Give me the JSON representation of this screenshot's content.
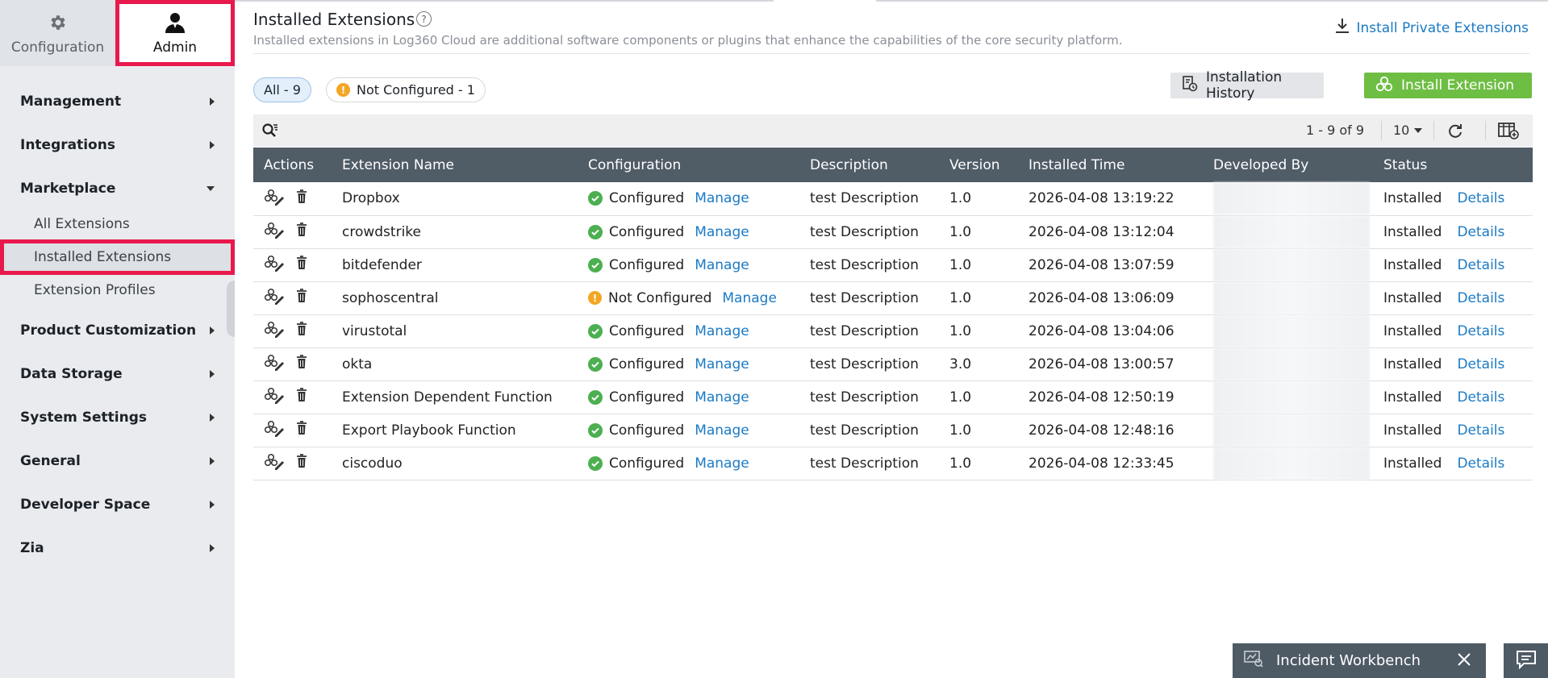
{
  "top_tabs": {
    "configuration": {
      "label": "Configuration",
      "icon": "gear-icon"
    },
    "admin": {
      "label": "Admin",
      "icon": "user-icon"
    }
  },
  "sidebar": {
    "sections": [
      {
        "label": "Management",
        "icon": "chevron-right-icon"
      },
      {
        "label": "Integrations",
        "icon": "chevron-right-icon"
      },
      {
        "label": "Marketplace",
        "icon": "chevron-down-icon",
        "children": [
          "All Extensions",
          "Installed Extensions",
          "Extension Profiles"
        ],
        "active_child": "Installed Extensions"
      },
      {
        "label": "Product Customization",
        "icon": "chevron-right-icon"
      },
      {
        "label": "Data Storage",
        "icon": "chevron-right-icon"
      },
      {
        "label": "System Settings",
        "icon": "chevron-right-icon"
      },
      {
        "label": "General",
        "icon": "chevron-right-icon"
      },
      {
        "label": "Developer Space",
        "icon": "chevron-right-icon"
      },
      {
        "label": "Zia",
        "icon": "chevron-right-icon"
      }
    ]
  },
  "header": {
    "title": "Installed Extensions",
    "subtitle": "Installed extensions in Log360 Cloud are additional software components or plugins that enhance the capabilities of the core security platform.",
    "private_link": "Install Private Extensions"
  },
  "filters": {
    "all": "All - 9",
    "not_configured": "Not Configured - 1"
  },
  "buttons": {
    "history": "Installation History",
    "install": "Install Extension"
  },
  "toolbar": {
    "pager": "1 - 9 of 9",
    "page_size": "10"
  },
  "table": {
    "columns": [
      "Actions",
      "Extension Name",
      "Configuration",
      "Description",
      "Version",
      "Installed Time",
      "Developed By",
      "Status"
    ],
    "rows": [
      {
        "name": "Dropbox",
        "config": "Configured",
        "configured": true,
        "manage": "Manage",
        "description": "test Description",
        "version": "1.0",
        "time": "2026-04-08 13:19:22",
        "status": "Installed",
        "details": "Details"
      },
      {
        "name": "crowdstrike",
        "config": "Configured",
        "configured": true,
        "manage": "Manage",
        "description": "test Description",
        "version": "1.0",
        "time": "2026-04-08 13:12:04",
        "status": "Installed",
        "details": "Details"
      },
      {
        "name": "bitdefender",
        "config": "Configured",
        "configured": true,
        "manage": "Manage",
        "description": "test Description",
        "version": "1.0",
        "time": "2026-04-08 13:07:59",
        "status": "Installed",
        "details": "Details"
      },
      {
        "name": "sophoscentral",
        "config": "Not Configured",
        "configured": false,
        "manage": "Manage",
        "description": "test Description",
        "version": "1.0",
        "time": "2026-04-08 13:06:09",
        "status": "Installed",
        "details": "Details"
      },
      {
        "name": "virustotal",
        "config": "Configured",
        "configured": true,
        "manage": "Manage",
        "description": "test Description",
        "version": "1.0",
        "time": "2026-04-08 13:04:06",
        "status": "Installed",
        "details": "Details"
      },
      {
        "name": "okta",
        "config": "Configured",
        "configured": true,
        "manage": "Manage",
        "description": "test Description",
        "version": "3.0",
        "time": "2026-04-08 13:00:57",
        "status": "Installed",
        "details": "Details"
      },
      {
        "name": "Extension Dependent Function",
        "config": "Configured",
        "configured": true,
        "manage": "Manage",
        "description": "test Description",
        "version": "1.0",
        "time": "2026-04-08 12:50:19",
        "status": "Installed",
        "details": "Details"
      },
      {
        "name": "Export Playbook Function",
        "config": "Configured",
        "configured": true,
        "manage": "Manage",
        "description": "test Description",
        "version": "1.0",
        "time": "2026-04-08 12:48:16",
        "status": "Installed",
        "details": "Details"
      },
      {
        "name": "ciscoduo",
        "config": "Configured",
        "configured": true,
        "manage": "Manage",
        "description": "test Description",
        "version": "1.0",
        "time": "2026-04-08 12:33:45",
        "status": "Installed",
        "details": "Details"
      }
    ]
  },
  "widgets": {
    "workbench": "Incident Workbench"
  },
  "colors": {
    "accent_blue": "#1b7ac4",
    "install_green": "#6fbe44",
    "ok_green": "#4caf50",
    "warn_orange": "#f4a623",
    "table_header": "#505c66",
    "highlight_red": "#e8194d"
  }
}
